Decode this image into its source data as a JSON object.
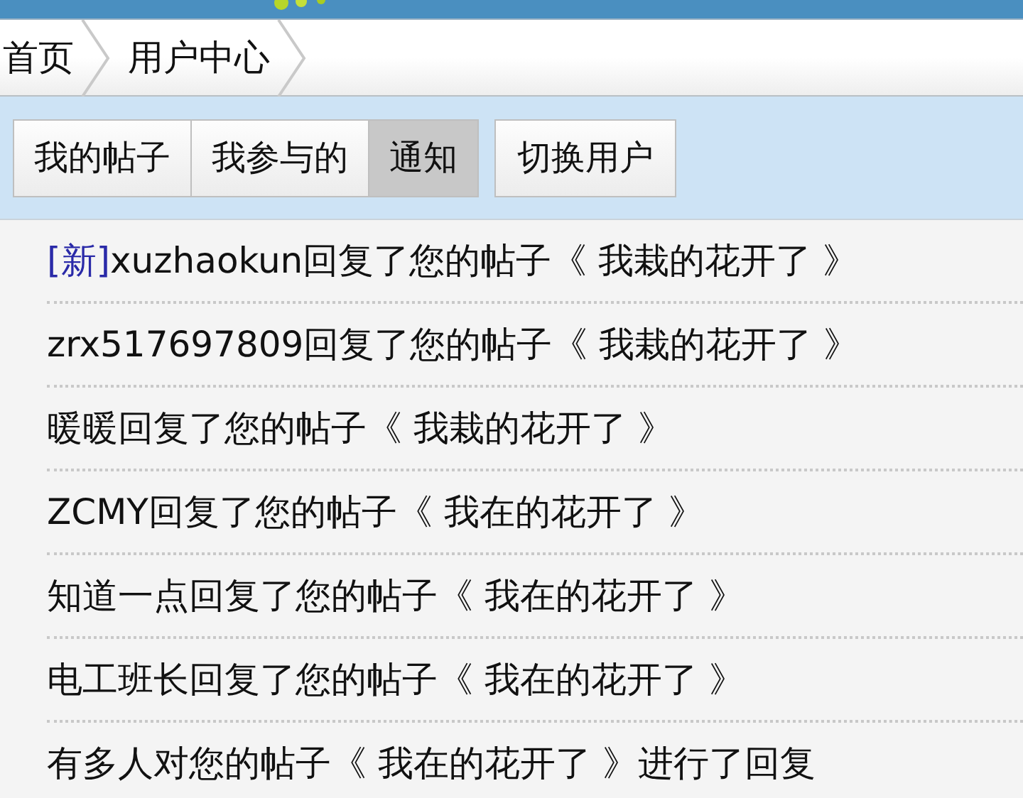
{
  "breadcrumb": [
    {
      "label": "首页"
    },
    {
      "label": "用户中心"
    }
  ],
  "tabs": [
    {
      "label": "我的帖子",
      "selected": false
    },
    {
      "label": "我参与的",
      "selected": false
    },
    {
      "label": "通知",
      "selected": true
    }
  ],
  "switch_user_button": {
    "label": "切换用户"
  },
  "notifications": [
    {
      "new_tag": "[新]",
      "text": "xuzhaokun回复了您的帖子《 我栽的花开了 》"
    },
    {
      "text": "zrx517697809回复了您的帖子《 我栽的花开了 》"
    },
    {
      "text": "暖暖回复了您的帖子《 我栽的花开了 》"
    },
    {
      "text": "ZCMY回复了您的帖子《 我在的花开了 》"
    },
    {
      "text": "知道一点回复了您的帖子《 我在的花开了 》"
    },
    {
      "text": "电工班长回复了您的帖子《 我在的花开了 》"
    },
    {
      "text": "有多人对您的帖子《 我在的花开了 》进行了回复"
    }
  ]
}
